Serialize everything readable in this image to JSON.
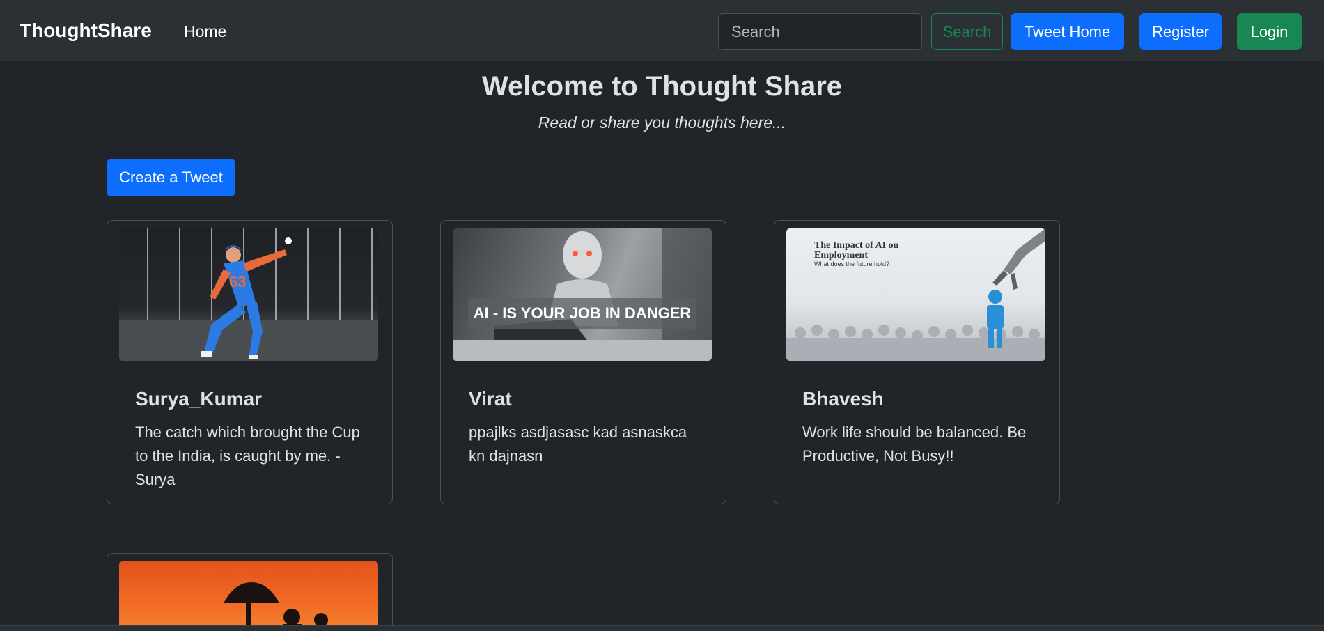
{
  "navbar": {
    "brand": "ThoughtShare",
    "home_link": "Home",
    "search_placeholder": "Search",
    "search_button": "Search",
    "tweet_home_button": "Tweet Home",
    "register_button": "Register",
    "login_button": "Login"
  },
  "hero": {
    "title": "Welcome to Thought Share",
    "subtitle": "Read or share you thoughts here..."
  },
  "create_button": "Create a Tweet",
  "cards": [
    {
      "author": "Surya_Kumar",
      "text": "The catch which brought the Cup to the India, is caught by me. - Surya",
      "image": "cricket-catch"
    },
    {
      "author": "Virat",
      "text": "ppajlks asdjasasc kad asnaskca kn dajnasn",
      "image": "ai-robot",
      "image_caption": "AI - IS YOUR JOB IN DANGER"
    },
    {
      "author": "Bhavesh",
      "text": "Work life should be balanced. Be Productive, Not Busy!!",
      "image": "ai-employment",
      "image_heading": "The Impact of AI on Employment",
      "image_subheading": "What does the future hold?"
    },
    {
      "author": "",
      "text": "",
      "image": "sunset-silhouette"
    }
  ],
  "colors": {
    "background": "#212529",
    "navbar": "#2b3035",
    "primary": "#0d6efd",
    "success": "#198754"
  }
}
